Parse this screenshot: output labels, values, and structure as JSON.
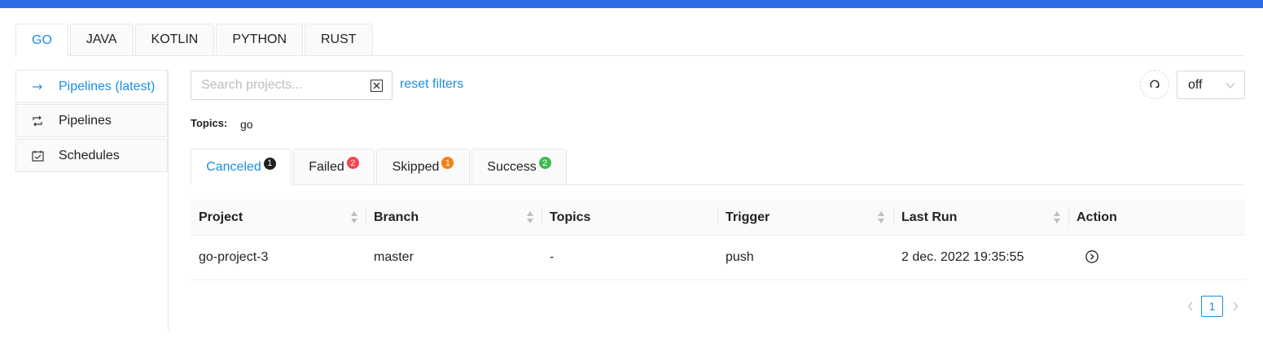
{
  "colors": {
    "accent": "#1a8ee0",
    "topbar": "#2b6be8",
    "badge_canceled": "#1f1f1f",
    "badge_failed": "#f5454e",
    "badge_skipped": "#f57f17",
    "badge_success": "#3dba4e"
  },
  "lang_tabs": [
    {
      "label": "GO",
      "active": true
    },
    {
      "label": "JAVA"
    },
    {
      "label": "KOTLIN"
    },
    {
      "label": "PYTHON"
    },
    {
      "label": "RUST"
    }
  ],
  "sidebar": {
    "items": [
      {
        "label": "Pipelines (latest)",
        "icon": "arrow-right-icon",
        "active": true
      },
      {
        "label": "Pipelines",
        "icon": "repeat-icon"
      },
      {
        "label": "Schedules",
        "icon": "schedule-icon"
      }
    ]
  },
  "search": {
    "placeholder": "Search projects...",
    "value": ""
  },
  "reset_label": "reset filters",
  "refresh_select": {
    "value": "off"
  },
  "topics": {
    "label": "Topics:",
    "value": "go"
  },
  "status_tabs": [
    {
      "label": "Canceled",
      "count": "1",
      "active": true
    },
    {
      "label": "Failed",
      "count": "2"
    },
    {
      "label": "Skipped",
      "count": "1"
    },
    {
      "label": "Success",
      "count": "2"
    }
  ],
  "table": {
    "columns": [
      "Project",
      "Branch",
      "Topics",
      "Trigger",
      "Last Run",
      "Action"
    ],
    "rows": [
      {
        "project": "go-project-3",
        "branch": "master",
        "topics": "-",
        "trigger": "push",
        "last_run": "2 dec. 2022 19:35:55"
      }
    ]
  },
  "pagination": {
    "current": "1"
  }
}
